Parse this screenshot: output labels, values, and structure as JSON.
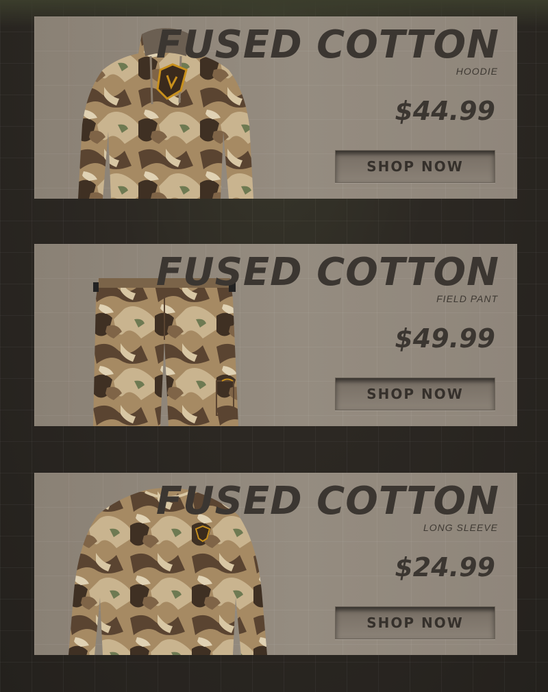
{
  "products": [
    {
      "title": "FUSED COTTON",
      "subtitle": "HOODIE",
      "price": "$44.99",
      "button_label": "SHOP NOW",
      "image_icon": "camo-hoodie-image"
    },
    {
      "title": "FUSED COTTON",
      "subtitle": "FIELD PANT",
      "price": "$49.99",
      "button_label": "SHOP NOW",
      "image_icon": "camo-field-pant-image"
    },
    {
      "title": "FUSED COTTON",
      "subtitle": "LONG SLEEVE",
      "price": "$24.99",
      "button_label": "SHOP NOW",
      "image_icon": "camo-long-sleeve-image"
    }
  ],
  "colors": {
    "page_bg": "#2e2a25",
    "card_bg": "#8e857a",
    "text": "#3b3631",
    "camo_dark": "#4a3a2a",
    "camo_mid": "#8a6e4e",
    "camo_light": "#c9b48f",
    "logo_accent": "#c8901c"
  }
}
